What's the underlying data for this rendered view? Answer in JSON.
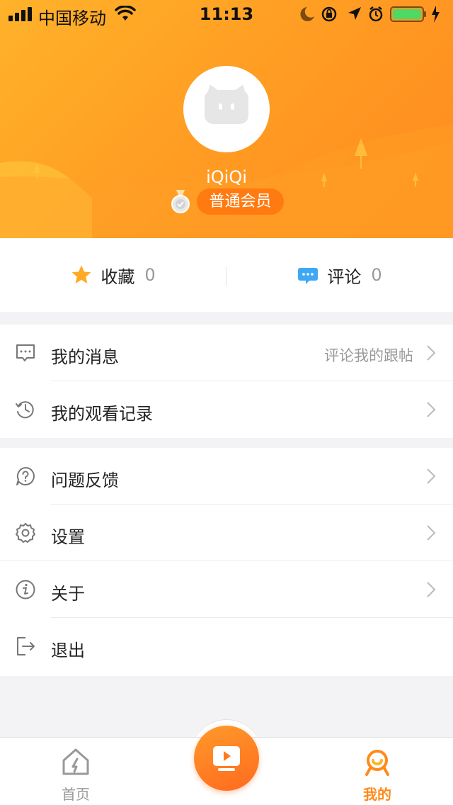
{
  "status_bar": {
    "carrier": "中国移动",
    "time": "11:13",
    "battery_level": 1.0
  },
  "profile": {
    "username": "iQiQi",
    "member_level": "普通会员"
  },
  "stats": {
    "favorites": {
      "label": "收藏",
      "count": "0",
      "icon": "star-icon"
    },
    "comments": {
      "label": "评论",
      "count": "0",
      "icon": "comment-bubble-icon"
    }
  },
  "menu": {
    "group1": [
      {
        "label": "我的消息",
        "hint": "评论我的跟帖",
        "icon": "message-icon"
      },
      {
        "label": "我的观看记录",
        "hint": "",
        "icon": "history-icon"
      }
    ],
    "group2": [
      {
        "label": "问题反馈",
        "icon": "question-icon"
      },
      {
        "label": "设置",
        "icon": "gear-icon"
      },
      {
        "label": "关于",
        "icon": "info-icon"
      },
      {
        "label": "退出",
        "icon": "logout-icon"
      }
    ]
  },
  "tabbar": {
    "home": {
      "label": "首页",
      "icon": "home-icon"
    },
    "center": {
      "icon": "video-play-icon"
    },
    "mine": {
      "label": "我的",
      "icon": "profile-icon",
      "active": true
    }
  },
  "colors": {
    "accent": "#ff8a1a",
    "header_start": "#ffb22a",
    "header_end": "#ff8a20",
    "badge": "#ff7a10"
  }
}
